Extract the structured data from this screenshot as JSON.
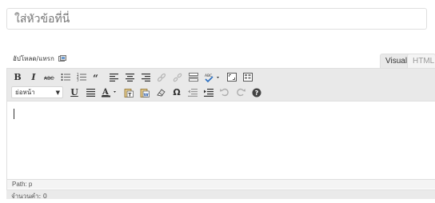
{
  "title_field": {
    "placeholder": "ใส่หัวข้อที่นี่"
  },
  "upload": {
    "label": "อัปโหลด/แทรก"
  },
  "tabs": {
    "visual": "Visual",
    "html": "HTML"
  },
  "toolbar": {
    "format_select": {
      "value": "ย่อหน้า"
    },
    "bold": "B",
    "italic": "I",
    "strike": "ABC",
    "underline": "U",
    "omega": "Ω"
  },
  "status": {
    "path_label": "Path: p"
  },
  "word_count": {
    "label": "จำนวนคำ: 0"
  },
  "colors": {
    "toolbar_bg": "#e9e9e9",
    "border": "#dfdfdf",
    "placeholder": "#a6a6a6"
  }
}
